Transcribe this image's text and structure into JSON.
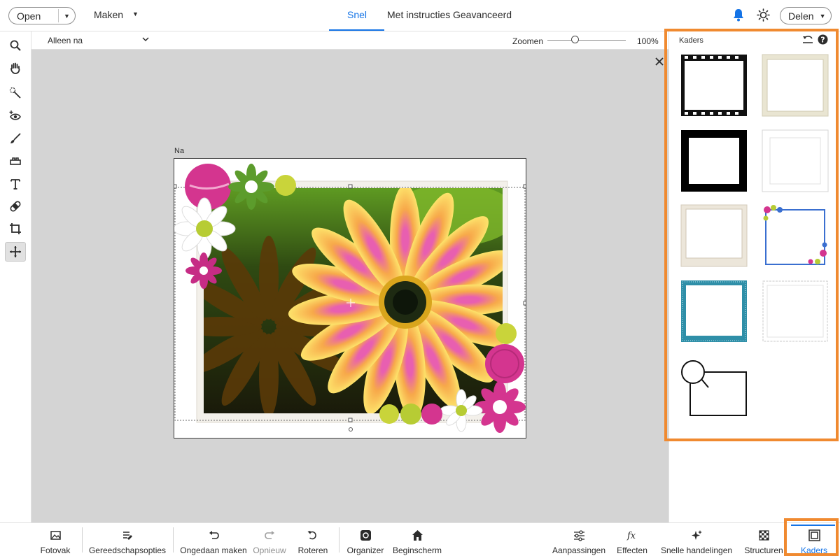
{
  "topbar": {
    "open_label": "Open",
    "maken_label": "Maken",
    "modes": [
      "Snel",
      "Met instructies",
      "Geavanceerd"
    ],
    "active_mode": "Snel",
    "share_label": "Delen"
  },
  "options": {
    "view": "Alleen na",
    "zoom_label": "Zoomen",
    "zoom_value": "100%",
    "zoom_level": 0.35
  },
  "canvas": {
    "doc_label": "Na"
  },
  "panel": {
    "title": "Kaders",
    "frames": [
      "film-strip-frame",
      "aged-paper-frame",
      "thick-black-frame",
      "thin-grey-frame",
      "polaroid-frame",
      "flower-border-frame",
      "blue-stitched-frame",
      "scalloped-frame",
      "speech-bubble-frame"
    ]
  },
  "bottombar": {
    "items": [
      {
        "label": "Fotovak",
        "icon": "photo-bin-icon"
      },
      {
        "label": "Gereedschapsopties",
        "icon": "tool-options-icon"
      },
      {
        "label": "Ongedaan maken",
        "icon": "undo-icon"
      },
      {
        "label": "Opnieuw",
        "icon": "redo-icon"
      },
      {
        "label": "Roteren",
        "icon": "rotate-icon"
      },
      {
        "label": "Organizer",
        "icon": "organizer-icon"
      },
      {
        "label": "Beginscherm",
        "icon": "home-icon"
      },
      {
        "label": "Aanpassingen",
        "icon": "adjustments-icon"
      },
      {
        "label": "Effecten",
        "icon": "effects-icon"
      },
      {
        "label": "Snelle handelingen",
        "icon": "quick-actions-icon"
      },
      {
        "label": "Structuren",
        "icon": "textures-icon"
      },
      {
        "label": "Kaders",
        "icon": "frames-icon"
      }
    ]
  },
  "colors": {
    "accent": "#1473e6",
    "highlight": "#f08a30",
    "canvas_bg": "#d4d4d4"
  }
}
